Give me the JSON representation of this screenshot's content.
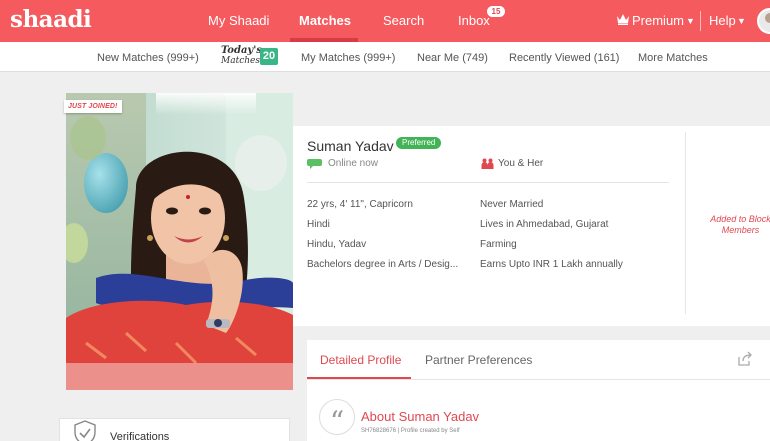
{
  "brand": {
    "logo": "shaadi",
    "accent": "#f55a5f",
    "badge_green": "#39b586"
  },
  "header": {
    "nav": [
      {
        "label": "My Shaadi",
        "active": false
      },
      {
        "label": "Matches",
        "active": true
      },
      {
        "label": "Search",
        "active": false
      },
      {
        "label": "Inbox",
        "active": false,
        "badge": "15"
      }
    ],
    "premium": "Premium",
    "help": "Help"
  },
  "subnav": {
    "new_matches": "New Matches (999+)",
    "todays_matches_line1": "Today's",
    "todays_matches_line2": "Matches",
    "todays_matches_count": "20",
    "my_matches": "My Matches (999+)",
    "near_me": "Near Me (749)",
    "recently_viewed": "Recently Viewed (161)",
    "more_matches": "More Matches"
  },
  "profile": {
    "just_joined": "JUST JOINED!",
    "name": "Suman Yadav",
    "preferred": "Preferred",
    "online": "Online now",
    "you_and_her": "You & Her",
    "details_left": [
      "22 yrs, 4' 11\", Capricorn",
      "Hindi",
      "Hindu, Yadav",
      "Bachelors degree in Arts / Desig..."
    ],
    "details_right": [
      "Never Married",
      "Lives in Ahmedabad, Gujarat",
      "Farming",
      "Earns Upto INR 1 Lakh annually"
    ],
    "blocked_line1": "Added to Block",
    "blocked_line2": "Members"
  },
  "tabs": {
    "detailed_profile": "Detailed Profile",
    "partner_preferences": "Partner Preferences",
    "active_tab": "Detailed Profile"
  },
  "about": {
    "title": "About Suman Yadav",
    "subtitle": "SH76828676  |  Profile created by Self"
  },
  "verifications": {
    "label": "Verifications"
  },
  "icons": [
    "crown-icon",
    "chevron-down-icon",
    "user-avatar",
    "chat-bubble-icon",
    "couple-icon",
    "share-icon",
    "quote-icon",
    "shield-check-icon"
  ]
}
